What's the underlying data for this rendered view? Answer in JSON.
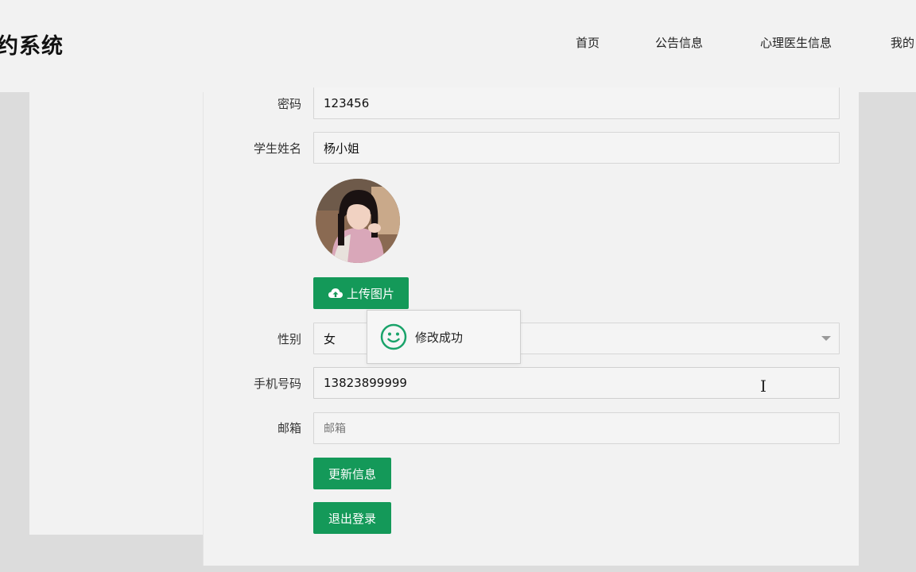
{
  "header": {
    "brand": "约系统",
    "nav": {
      "home": "首页",
      "notice": "公告信息",
      "doctor": "心理医生信息",
      "mine": "我的"
    }
  },
  "form": {
    "password": {
      "label": "密码",
      "value": "123456"
    },
    "student_name": {
      "label": "学生姓名",
      "value": "杨小姐"
    },
    "upload_button": "上传图片",
    "gender": {
      "label": "性别",
      "value": "女"
    },
    "phone": {
      "label": "手机号码",
      "value": "13823899999"
    },
    "email": {
      "label": "邮箱",
      "placeholder": "邮箱"
    },
    "update_button": "更新信息",
    "logout_button": "退出登录"
  },
  "toast": {
    "message": "修改成功"
  },
  "colors": {
    "accent": "#149959",
    "toast_icon": "#1aa36a"
  }
}
